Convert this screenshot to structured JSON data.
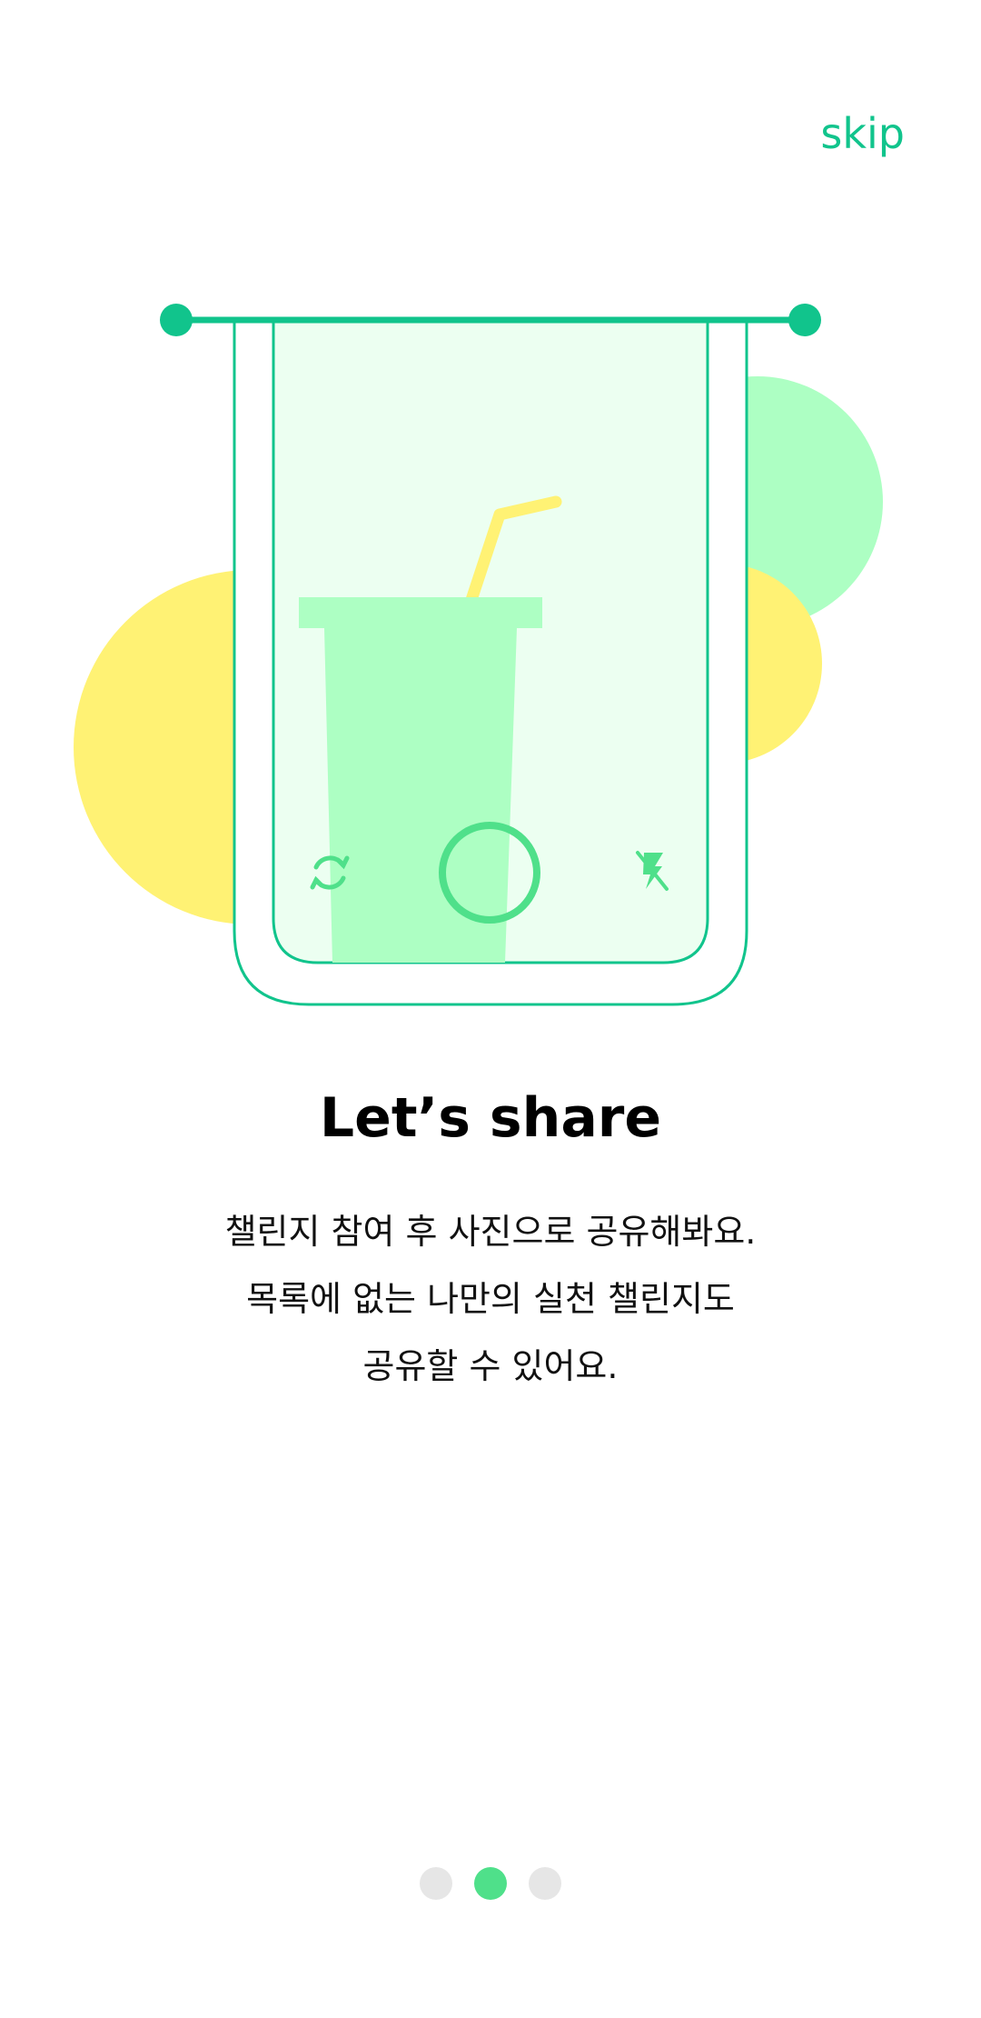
{
  "header": {
    "skip_label": "skip"
  },
  "illustration": {
    "icons": [
      "camera-switch-icon",
      "shutter-button-icon",
      "flash-off-icon",
      "drink-cup-icon",
      "straw-icon"
    ],
    "colors": {
      "accent": "#11c48c",
      "light_green": "#adffc3",
      "pale_green": "#ecfff1",
      "yellow": "#fff274",
      "control_green": "#4fe08a"
    }
  },
  "content": {
    "title": "Let’s share",
    "description_lines": [
      "챌린지 참여 후 사진으로 공유해봐요.",
      "목록에 없는 나만의 실천 챌린지도",
      "공유할 수 있어요."
    ]
  },
  "pager": {
    "total": 3,
    "current": 2,
    "active_color": "#4fe08a",
    "inactive_color": "#e6e6e6"
  }
}
